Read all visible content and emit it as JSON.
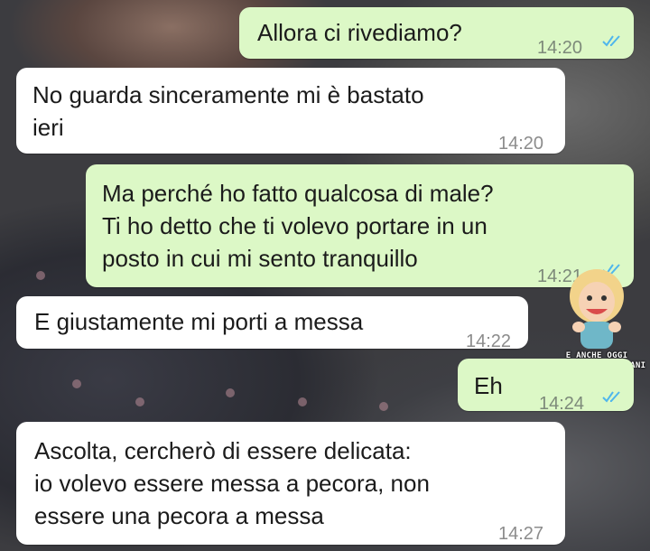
{
  "chat": {
    "messages": [
      {
        "direction": "outgoing",
        "lines": [
          "Allora ci rivediamo?"
        ],
        "time": "14:20",
        "status": "read"
      },
      {
        "direction": "incoming",
        "lines": [
          "No guarda sinceramente mi è bastato",
          "ieri"
        ],
        "time": "14:20"
      },
      {
        "direction": "outgoing",
        "lines": [
          "Ma perché ho fatto qualcosa di male?",
          "Ti ho detto che ti volevo portare in un",
          "posto in cui mi sento tranquillo"
        ],
        "time": "14:21",
        "status": "read"
      },
      {
        "direction": "incoming",
        "lines": [
          "E giustamente mi porti a messa"
        ],
        "time": "14:22"
      },
      {
        "direction": "outgoing",
        "lines": [
          "Eh"
        ],
        "time": "14:24",
        "status": "read"
      },
      {
        "direction": "incoming",
        "lines": [
          "Ascolta, cercherò di essere delicata:",
          "io volevo essere messa a pecora, non",
          "essere una pecora a messa"
        ],
        "time": "14:27"
      }
    ]
  },
  "watermark": {
    "line1": "E ANCHE OGGI",
    "line2": "SI RIMORCHIA DOMANI"
  },
  "colors": {
    "outgoing_bubble": "#dcf8c6",
    "incoming_bubble": "#ffffff",
    "read_ticks": "#4fb6ec"
  },
  "icons": {
    "read_receipt": "double-check-icon"
  }
}
